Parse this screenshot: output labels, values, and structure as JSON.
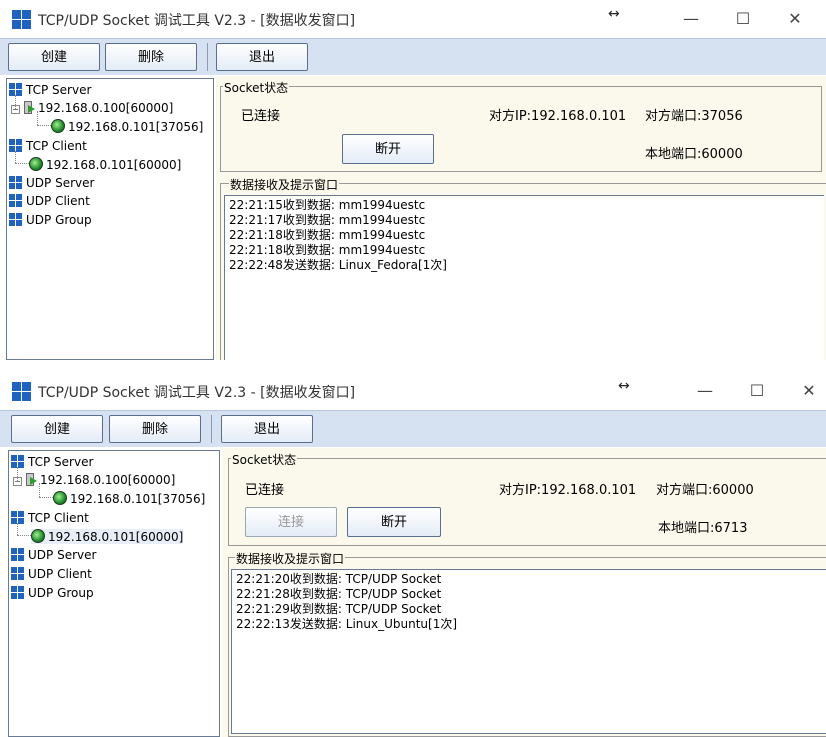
{
  "windows": [
    {
      "title": "TCP/UDP Socket 调试工具 V2.3 - [数据收发窗口]",
      "toolbar": {
        "create": "创建",
        "delete": "删除",
        "exit": "退出"
      },
      "tree": {
        "tcp_server": "TCP Server",
        "server_node": "192.168.0.100[60000]",
        "server_child": "192.168.0.101[37056]",
        "tcp_client": "TCP Client",
        "client_node": "192.168.0.101[60000]",
        "udp_server": "UDP Server",
        "udp_client": "UDP Client",
        "udp_group": "UDP Group"
      },
      "socket": {
        "legend": "Socket状态",
        "status": "已连接",
        "remote_ip": "对方IP:192.168.0.101",
        "remote_port": "对方端口:37056",
        "local_port": "本地端口:60000",
        "disconnect": "断开"
      },
      "recv": {
        "legend": "数据接收及提示窗口",
        "log": "22:21:15收到数据: mm1994uestc\n22:21:17收到数据: mm1994uestc\n22:21:18收到数据: mm1994uestc\n22:21:18收到数据: mm1994uestc\n22:22:48发送数据: Linux_Fedora[1次]"
      }
    },
    {
      "title": "TCP/UDP Socket 调试工具 V2.3 - [数据收发窗口]",
      "toolbar": {
        "create": "创建",
        "delete": "删除",
        "exit": "退出"
      },
      "tree": {
        "tcp_server": "TCP Server",
        "server_node": "192.168.0.100[60000]",
        "server_child": "192.168.0.101[37056]",
        "tcp_client": "TCP Client",
        "client_node": "192.168.0.101[60000]",
        "udp_server": "UDP Server",
        "udp_client": "UDP Client",
        "udp_group": "UDP Group"
      },
      "socket": {
        "legend": "Socket状态",
        "status": "已连接",
        "remote_ip": "对方IP:192.168.0.101",
        "remote_port": "对方端口:60000",
        "local_port": "本地端口:6713",
        "connect": "连接",
        "disconnect": "断开"
      },
      "recv": {
        "legend": "数据接收及提示窗口",
        "log": "22:21:20收到数据: TCP/UDP Socket\n22:21:28收到数据: TCP/UDP Socket\n22:21:29收到数据: TCP/UDP Socket\n22:22:13发送数据: Linux_Ubuntu[1次]"
      }
    }
  ],
  "glyphs": {
    "resize": "↔",
    "minimize": "—",
    "maximize": "☐",
    "close": "✕"
  },
  "colors": {
    "toolbar_bg": "#d6e2f2",
    "pane_bg": "#fbf8ec",
    "icon_blue": "#1e63c4"
  }
}
